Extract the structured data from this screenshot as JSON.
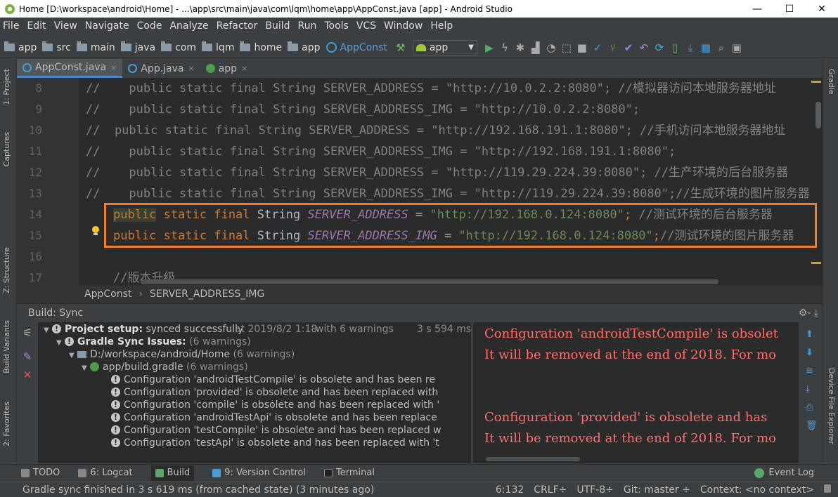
{
  "window": {
    "title": "Home [D:\\workspace\\android\\Home] - ...\\app\\src\\main\\java\\com\\lqm\\home\\app\\AppConst.java [app] - Android Studio",
    "minimize": "—",
    "maximize": "☐",
    "close": "✕"
  },
  "menu": [
    "File",
    "Edit",
    "View",
    "Navigate",
    "Code",
    "Analyze",
    "Refactor",
    "Build",
    "Run",
    "Tools",
    "VCS",
    "Window",
    "Help"
  ],
  "breadcrumbs": [
    "app",
    "src",
    "main",
    "java",
    "com",
    "lqm",
    "home",
    "app",
    "AppConst"
  ],
  "run_config": "app",
  "tabs": [
    {
      "label": "AppConst.java",
      "close": "×"
    },
    {
      "label": "App.java",
      "close": "×"
    },
    {
      "label": "app",
      "close": "×"
    }
  ],
  "left_tools": [
    "1: Project",
    "Captures",
    "Z: Structure",
    "Build Variants",
    "2: Favorites"
  ],
  "right_tools": [
    "Gradle",
    "Device File Explorer"
  ],
  "code": {
    "line_numbers": [
      "8",
      "9",
      "10",
      "11",
      "12",
      "13",
      "14",
      "15",
      "16",
      "17"
    ],
    "l8": {
      "comment": "//    public static final String SERVER_ADDRESS = \"http://10.0.2.2:8080\"; //模拟器访问本地服务器地址"
    },
    "l9": {
      "comment": "//    public static final String SERVER_ADDRESS_IMG = \"http://10.0.2.2:8080\";"
    },
    "l10": {
      "comment": "//  public static final String SERVER_ADDRESS = \"http://192.168.191.1:8080\"; //手机访问本地服务器地址"
    },
    "l11": {
      "comment": "//    public static final String SERVER_ADDRESS_IMG = \"http://192.168.191.1:8080\";"
    },
    "l12": {
      "comment": "//    public static final String SERVER_ADDRESS = \"http://119.29.224.39:8080\"; //生产环境的后台服务器"
    },
    "l13": {
      "comment": "//    public static final String SERVER_ADDRESS_IMG = \"http://119.29.224.39:8080\";//生成环境的图片服务器"
    },
    "l14": {
      "kw1": "public",
      "kw2": "static",
      "kw3": "final",
      "type": "String",
      "field": "SERVER_ADDRESS",
      "eq": "=",
      "value": "\"http://192.168.0.124:8080\"",
      "tail": ";",
      "comment": "//测试环境的后台服务器"
    },
    "l15": {
      "kw1": "public",
      "kw2": "static",
      "kw3": "final",
      "type": "String",
      "field": "SERVER_ADDRESS_IMG",
      "eq": "=",
      "value": "\"http://192.168.0.124:8080\"",
      "tail": ";",
      "comment": "//测试环境的图片服务器"
    },
    "l16": {
      "comment": ""
    },
    "l17": {
      "comment": "//版本升级"
    }
  },
  "code_breadcrumb": [
    "AppConst",
    "SERVER_ADDRESS_IMG"
  ],
  "build": {
    "header": "Build: Sync",
    "header_icons": "⚙- ⤓",
    "tree": {
      "setup": {
        "label": "Project setup:",
        "status": "synced successfully",
        "time": "at 2019/8/2 1:18",
        "warnings": "with 6 warnings",
        "duration": "3 s 594 ms"
      },
      "sync_issues": {
        "label": "Gradle Sync Issues:",
        "count": "(6 warnings)"
      },
      "folder": {
        "label": "D:/workspace/android/Home",
        "count": "(6 warnings)"
      },
      "gradle_file": {
        "label": "app/build.gradle",
        "count": "(6 warnings)"
      },
      "items": [
        "Configuration 'androidTestCompile' is obsolete and has been re",
        "Configuration 'provided' is obsolete and has been replaced with",
        "Configuration 'compile' is obsolete and has been replaced with '",
        "Configuration 'androidTestApi' is obsolete and has been replace",
        "Configuration 'testCompile' is obsolete and has been replaced w",
        "Configuration 'testApi' is obsolete and has been replaced with 't"
      ]
    },
    "console": [
      "Configuration 'androidTestCompile' is obsolet",
      "It will be removed at the end of 2018. For mo",
      "",
      "",
      "Configuration 'provided' is obsolete and has",
      "It will be removed at the end of 2018. For mo"
    ]
  },
  "bottom_tabs": [
    {
      "label": "TODO"
    },
    {
      "label": "6: Logcat"
    },
    {
      "label": "Build"
    },
    {
      "label": "9: Version Control"
    },
    {
      "label": "Terminal"
    }
  ],
  "event_log": "Event Log",
  "status": {
    "message": "Gradle sync finished in 3 s 619 ms (from cached state) (3 minutes ago)",
    "position": "6:132",
    "line_sep": "CRLF÷",
    "encoding": "UTF-8÷",
    "git": "Git: master ÷",
    "context": "Context: <no context>"
  }
}
